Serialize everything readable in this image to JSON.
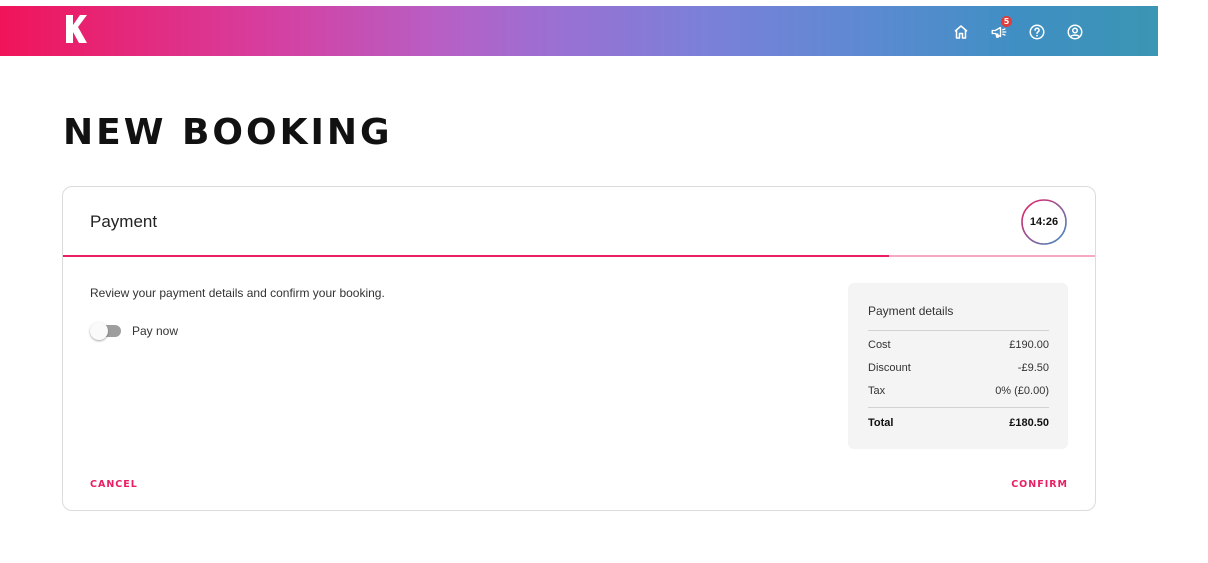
{
  "header": {
    "logo_icon": "k-logo-icon",
    "gradient": [
      "#f0145a",
      "#b75fc5",
      "#7d7fd8",
      "#3b95b3"
    ],
    "icons": [
      "home-icon",
      "megaphone-icon",
      "help-icon",
      "account-icon"
    ],
    "notifications_count": "5"
  },
  "page": {
    "title": "NEW BOOKING"
  },
  "card": {
    "title": "Payment",
    "timer": "14:26",
    "progress_percent": 80,
    "intro": "Review your payment details and confirm your booking.",
    "pay_now": {
      "label": "Pay now",
      "on": false
    },
    "details": {
      "title": "Payment details",
      "rows": [
        {
          "label": "Cost",
          "value": "£190.00"
        },
        {
          "label": "Discount",
          "value": "-£9.50"
        },
        {
          "label": "Tax",
          "value": "0% (£0.00)"
        }
      ],
      "total": {
        "label": "Total",
        "value": "£180.50"
      }
    },
    "cancel_label": "CANCEL",
    "confirm_label": "CONFIRM"
  },
  "colors": {
    "accent": "#e91e63",
    "progress_track": "#f7a9c4",
    "panel": "#f4f4f4"
  }
}
